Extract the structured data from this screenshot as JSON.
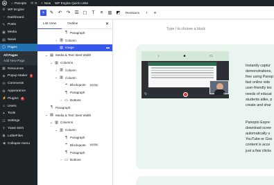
{
  "admin_bar": {
    "site_name": "Panopto",
    "comments": "0",
    "new_label": "New",
    "quick_links": "WP Engine Quick Links"
  },
  "sidebar": {
    "items_top": [
      {
        "icon": "engine-icon",
        "glyph": "⚙",
        "label": "WP Engine"
      },
      {
        "icon": "dashboard-icon",
        "glyph": "◔",
        "label": "Dashboard"
      },
      {
        "icon": "posts-icon",
        "glyph": "✎",
        "label": "Posts"
      },
      {
        "icon": "media-icon",
        "glyph": "▣",
        "label": "Media"
      },
      {
        "icon": "news-icon",
        "glyph": "▤",
        "label": "News"
      },
      {
        "icon": "pages-icon",
        "glyph": "▢",
        "label": "Pages"
      }
    ],
    "submenu": [
      "All Pages",
      "Add New Page"
    ],
    "items_bottom": [
      {
        "icon": "resources-icon",
        "glyph": "▦",
        "label": "Resources",
        "badge": ""
      },
      {
        "icon": "popup-maker-icon",
        "glyph": "◈",
        "label": "Popup Maker",
        "badge": "1"
      },
      {
        "icon": "comments-icon",
        "glyph": "✉",
        "label": "Comments",
        "badge": ""
      },
      {
        "icon": "appearance-icon",
        "glyph": "✿",
        "label": "Appearance",
        "badge": ""
      },
      {
        "icon": "plugins-icon",
        "glyph": "⚡",
        "label": "Plugins",
        "badge": "8"
      },
      {
        "icon": "users-icon",
        "glyph": "☺",
        "label": "Users",
        "badge": ""
      },
      {
        "icon": "tools-icon",
        "glyph": "✦",
        "label": "Tools",
        "badge": ""
      },
      {
        "icon": "settings-icon",
        "glyph": "☷",
        "label": "Settings",
        "badge": ""
      },
      {
        "icon": "yoast-icon",
        "glyph": "Y",
        "label": "Yoast SEO",
        "badge": ""
      },
      {
        "icon": "lottie-icon",
        "glyph": "◉",
        "label": "LottieFiles",
        "badge": ""
      },
      {
        "icon": "collapse-icon",
        "glyph": "◀",
        "label": "Collapse menu",
        "badge": ""
      }
    ]
  },
  "toolbar": {
    "revisions_label": "Revisions"
  },
  "list_view": {
    "tab_list": "List View",
    "tab_outline": "Outline",
    "rows": [
      {
        "indent": 4,
        "chevron": "",
        "icon": "paragraph-icon",
        "glyph": "¶",
        "label": "Paragraph",
        "chip": "",
        "selected": false
      },
      {
        "indent": 3,
        "chevron": "›",
        "icon": "column-icon",
        "glyph": "▥",
        "label": "Column",
        "chip": "",
        "selected": false
      },
      {
        "indent": 3,
        "chevron": "",
        "icon": "image-icon",
        "glyph": "▨",
        "label": "Image",
        "chip": "",
        "selected": true
      },
      {
        "indent": 1,
        "chevron": "⌄",
        "icon": "media-text-icon",
        "glyph": "▤",
        "label": "Media & Text: Best Width",
        "chip": "",
        "selected": false
      },
      {
        "indent": 2,
        "chevron": "⌄",
        "icon": "columns-icon",
        "glyph": "▥",
        "label": "Columns",
        "chip": "",
        "selected": false
      },
      {
        "indent": 3,
        "chevron": "›",
        "icon": "column-icon",
        "glyph": "▥",
        "label": "Column",
        "chip": "",
        "selected": false
      },
      {
        "indent": 3,
        "chevron": "⌄",
        "icon": "column-icon",
        "glyph": "▥",
        "label": "Column",
        "chip": "",
        "selected": false
      },
      {
        "indent": 4,
        "chevron": "",
        "icon": "blockquote-icon",
        "glyph": "❝",
        "label": "Blockquote",
        "chip": "h4 Ric",
        "selected": false
      },
      {
        "indent": 4,
        "chevron": "",
        "icon": "paragraph-icon",
        "glyph": "¶",
        "label": "Paragraph",
        "chip": "",
        "selected": false
      },
      {
        "indent": 4,
        "chevron": "›",
        "icon": "buttons-icon",
        "glyph": "▭",
        "label": "Buttons",
        "chip": "",
        "selected": false
      },
      {
        "indent": 1,
        "chevron": "",
        "icon": "paragraph-icon",
        "glyph": "¶",
        "label": "Paragraph",
        "chip": "",
        "selected": false
      },
      {
        "indent": 1,
        "chevron": "⌄",
        "icon": "media-text-icon",
        "glyph": "▤",
        "label": "Media & Text: Best Width",
        "chip": "",
        "selected": false
      },
      {
        "indent": 2,
        "chevron": "⌄",
        "icon": "columns-icon",
        "glyph": "▥",
        "label": "Columns",
        "chip": "",
        "selected": false
      },
      {
        "indent": 3,
        "chevron": "⌄",
        "icon": "column-icon",
        "glyph": "▥",
        "label": "Column",
        "chip": "",
        "selected": false
      },
      {
        "indent": 4,
        "chevron": "",
        "icon": "paragraph-icon",
        "glyph": "¶",
        "label": "Paragraph",
        "chip": "",
        "selected": false
      },
      {
        "indent": 4,
        "chevron": "",
        "icon": "blockquote-icon",
        "glyph": "❝",
        "label": "Blockquote",
        "chip": "h4 Ric",
        "selected": false
      },
      {
        "indent": 4,
        "chevron": "",
        "icon": "paragraph-icon",
        "glyph": "¶",
        "label": "Paragraph",
        "chip": "",
        "selected": false
      },
      {
        "indent": 4,
        "chevron": "›",
        "icon": "buttons-icon",
        "glyph": "▭",
        "label": "Buttons",
        "chip": "",
        "selected": false
      }
    ]
  },
  "canvas": {
    "placeholder": "Type / to choose a block",
    "paragraph1": [
      "Instantly captur",
      "demonstrations,",
      "free using Panop",
      "fast online vide",
      "user-friendly tex",
      "needs of educat",
      "students alike, p",
      "create and shar"
    ],
    "paragraph2": [
      "Panopto Expre",
      "download scree",
      "automatically u",
      "YouTube or Goo",
      "content is acce",
      "just a few clicks"
    ]
  }
}
